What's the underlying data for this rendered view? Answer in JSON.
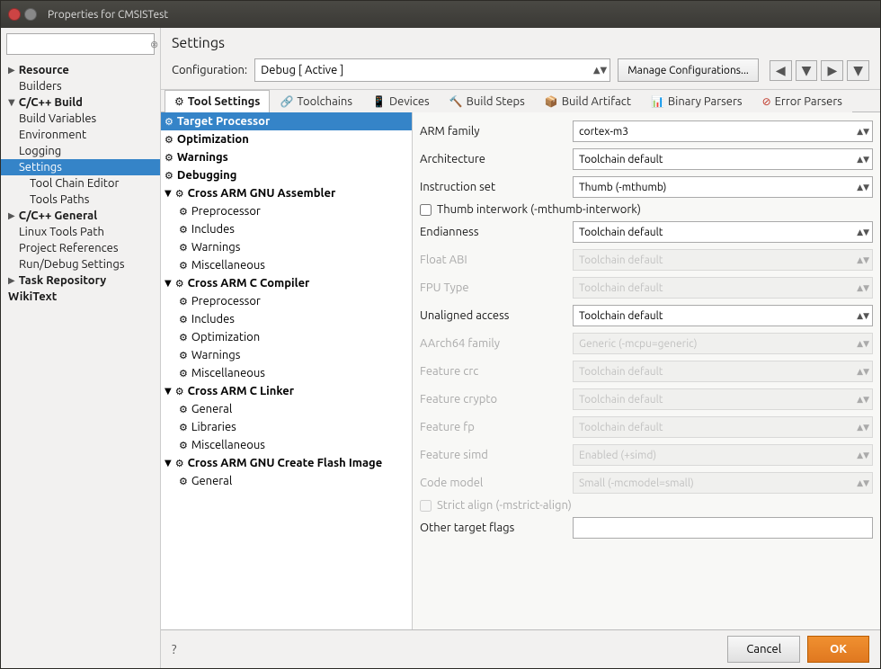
{
  "window": {
    "title": "Properties for CMSISTest"
  },
  "sidebar": {
    "search_placeholder": "",
    "items": [
      {
        "id": "resource",
        "label": "Resource",
        "level": 1,
        "expand": true,
        "selected": false
      },
      {
        "id": "builders",
        "label": "Builders",
        "level": 2,
        "selected": false
      },
      {
        "id": "cpp-build",
        "label": "C/C++ Build",
        "level": 1,
        "expand": true,
        "selected": false
      },
      {
        "id": "build-variables",
        "label": "Build Variables",
        "level": 2,
        "selected": false
      },
      {
        "id": "environment",
        "label": "Environment",
        "level": 2,
        "selected": false
      },
      {
        "id": "logging",
        "label": "Logging",
        "level": 2,
        "selected": false
      },
      {
        "id": "settings",
        "label": "Settings",
        "level": 2,
        "selected": true
      },
      {
        "id": "tool-chain-editor",
        "label": "Tool Chain Editor",
        "level": 3,
        "selected": false
      },
      {
        "id": "tools-paths",
        "label": "Tools Paths",
        "level": 3,
        "selected": false
      },
      {
        "id": "cpp-general",
        "label": "C/C++ General",
        "level": 1,
        "expand": false,
        "selected": false
      },
      {
        "id": "linux-tools-path",
        "label": "Linux Tools Path",
        "level": 2,
        "selected": false
      },
      {
        "id": "project-references",
        "label": "Project References",
        "level": 2,
        "selected": false
      },
      {
        "id": "run-debug-settings",
        "label": "Run/Debug Settings",
        "level": 2,
        "selected": false
      },
      {
        "id": "task-repository",
        "label": "Task Repository",
        "level": 1,
        "expand": false,
        "selected": false
      },
      {
        "id": "wikitext",
        "label": "WikiText",
        "level": 1,
        "selected": false
      }
    ]
  },
  "main": {
    "title": "Settings",
    "configuration_label": "Configuration:",
    "configuration_value": "Debug [ Active ]",
    "manage_btn_label": "Manage Configurations...",
    "tabs": [
      {
        "id": "tool-settings",
        "label": "Tool Settings",
        "active": true,
        "icon": "⚙"
      },
      {
        "id": "toolchains",
        "label": "Toolchains",
        "active": false,
        "icon": "🔗"
      },
      {
        "id": "devices",
        "label": "Devices",
        "active": false,
        "icon": "📱"
      },
      {
        "id": "build-steps",
        "label": "Build Steps",
        "active": false,
        "icon": "🔨"
      },
      {
        "id": "build-artifact",
        "label": "Build Artifact",
        "active": false,
        "icon": "📦"
      },
      {
        "id": "binary-parsers",
        "label": "Binary Parsers",
        "active": false,
        "icon": "📊"
      },
      {
        "id": "error-parsers",
        "label": "Error Parsers",
        "active": false,
        "icon": "❌"
      }
    ]
  },
  "tool_tree": {
    "items": [
      {
        "id": "target-processor",
        "label": "Target Processor",
        "level": 1,
        "selected": true
      },
      {
        "id": "optimization",
        "label": "Optimization",
        "level": 1,
        "selected": false
      },
      {
        "id": "warnings",
        "label": "Warnings",
        "level": 1,
        "selected": false
      },
      {
        "id": "debugging",
        "label": "Debugging",
        "level": 1,
        "selected": false
      },
      {
        "id": "cross-asm",
        "label": "Cross ARM GNU Assembler",
        "level": 1,
        "expand": true,
        "selected": false
      },
      {
        "id": "asm-preprocessor",
        "label": "Preprocessor",
        "level": 2,
        "selected": false
      },
      {
        "id": "asm-includes",
        "label": "Includes",
        "level": 2,
        "selected": false
      },
      {
        "id": "asm-warnings",
        "label": "Warnings",
        "level": 2,
        "selected": false
      },
      {
        "id": "asm-misc",
        "label": "Miscellaneous",
        "level": 2,
        "selected": false
      },
      {
        "id": "cross-c-compiler",
        "label": "Cross ARM C Compiler",
        "level": 1,
        "expand": true,
        "selected": false
      },
      {
        "id": "cc-preprocessor",
        "label": "Preprocessor",
        "level": 2,
        "selected": false
      },
      {
        "id": "cc-includes",
        "label": "Includes",
        "level": 2,
        "selected": false
      },
      {
        "id": "cc-optimization",
        "label": "Optimization",
        "level": 2,
        "selected": false
      },
      {
        "id": "cc-warnings",
        "label": "Warnings",
        "level": 2,
        "selected": false
      },
      {
        "id": "cc-misc",
        "label": "Miscellaneous",
        "level": 2,
        "selected": false
      },
      {
        "id": "cross-c-linker",
        "label": "Cross ARM C Linker",
        "level": 1,
        "expand": true,
        "selected": false
      },
      {
        "id": "cl-general",
        "label": "General",
        "level": 2,
        "selected": false
      },
      {
        "id": "cl-libraries",
        "label": "Libraries",
        "level": 2,
        "selected": false
      },
      {
        "id": "cl-misc",
        "label": "Miscellaneous",
        "level": 2,
        "selected": false
      },
      {
        "id": "cross-flash",
        "label": "Cross ARM GNU Create Flash Image",
        "level": 1,
        "expand": true,
        "selected": false
      },
      {
        "id": "flash-general",
        "label": "General",
        "level": 2,
        "selected": false
      }
    ]
  },
  "settings": {
    "arm_family_label": "ARM family",
    "arm_family_value": "cortex-m3",
    "architecture_label": "Architecture",
    "architecture_value": "Toolchain default",
    "instruction_set_label": "Instruction set",
    "instruction_set_value": "Thumb (-mthumb)",
    "thumb_interwork_label": "Thumb interwork (-mthumb-interwork)",
    "thumb_interwork_checked": false,
    "endianness_label": "Endianness",
    "endianness_value": "Toolchain default",
    "float_abi_label": "Float ABI",
    "float_abi_value": "Toolchain default",
    "float_abi_disabled": true,
    "fpu_type_label": "FPU Type",
    "fpu_type_value": "Toolchain default",
    "fpu_type_disabled": true,
    "unaligned_access_label": "Unaligned access",
    "unaligned_access_value": "Toolchain default",
    "aarch64_family_label": "AArch64 family",
    "aarch64_family_value": "Generic (-mcpu=generic)",
    "aarch64_family_disabled": true,
    "feature_crc_label": "Feature crc",
    "feature_crc_value": "Toolchain default",
    "feature_crc_disabled": true,
    "feature_crypto_label": "Feature crypto",
    "feature_crypto_value": "Toolchain default",
    "feature_crypto_disabled": true,
    "feature_fp_label": "Feature fp",
    "feature_fp_value": "Toolchain default",
    "feature_fp_disabled": true,
    "feature_simd_label": "Feature simd",
    "feature_simd_value": "Enabled (+simd)",
    "feature_simd_disabled": true,
    "code_model_label": "Code model",
    "code_model_value": "Small (-mcmodel=small)",
    "code_model_disabled": true,
    "strict_align_label": "Strict align (-mstrict-align)",
    "strict_align_checked": false,
    "strict_align_disabled": true,
    "other_target_flags_label": "Other target flags"
  },
  "bottom": {
    "cancel_label": "Cancel",
    "ok_label": "OK"
  }
}
